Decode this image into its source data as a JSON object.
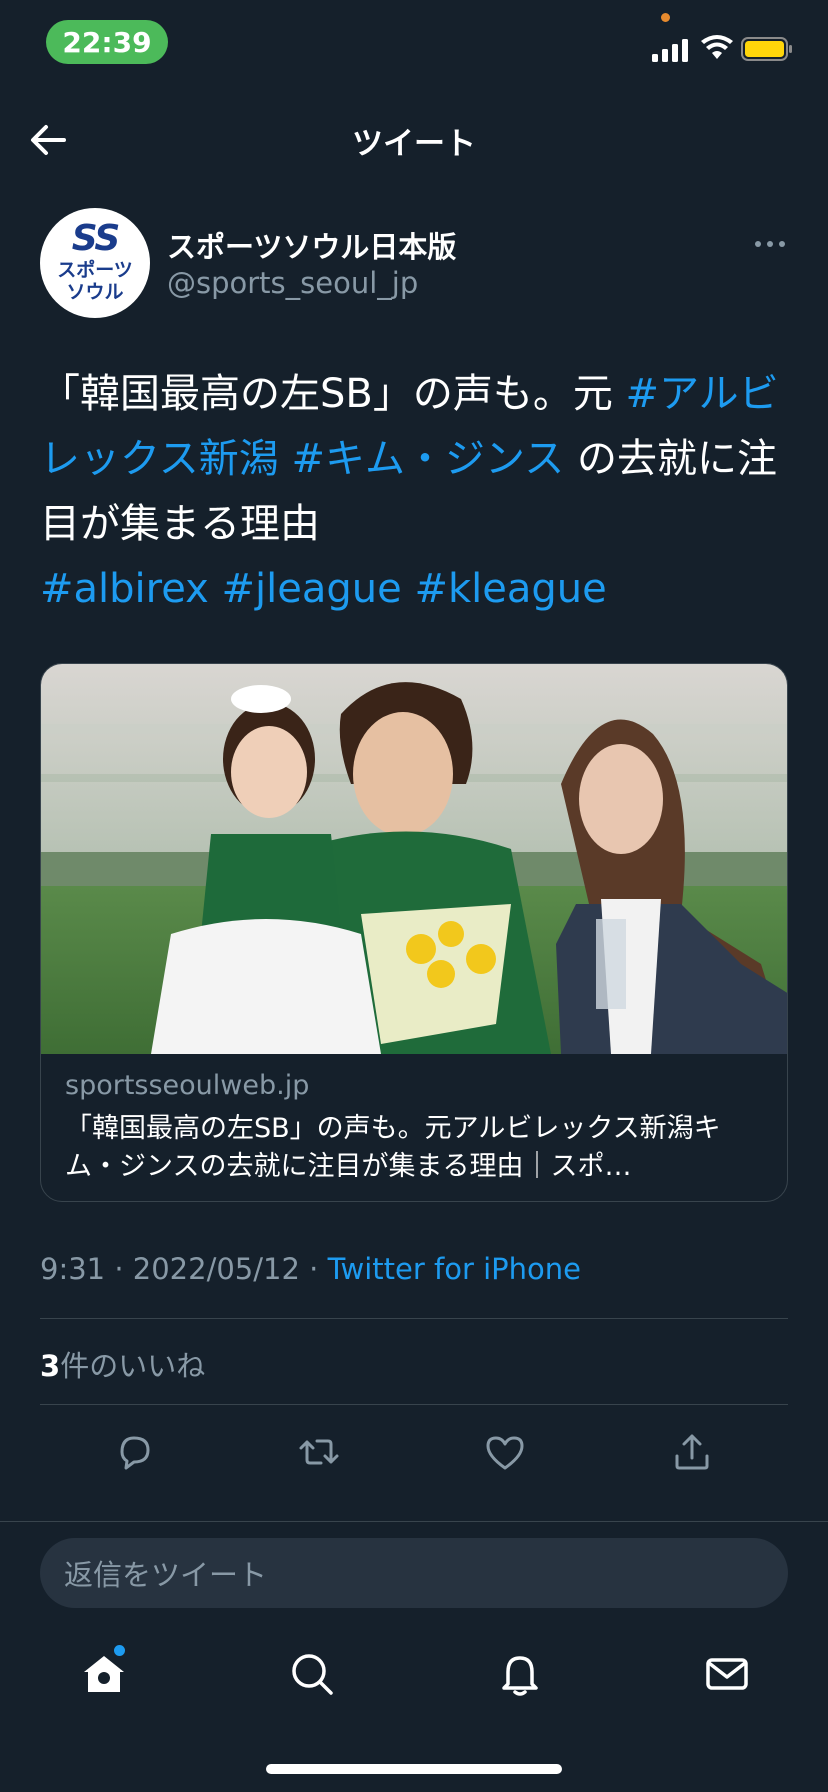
{
  "status_bar": {
    "time": "22:39"
  },
  "header": {
    "title": "ツイート"
  },
  "author": {
    "name": "スポーツソウル日本版",
    "handle": "@sports_seoul_jp",
    "avatar_line1": "SS",
    "avatar_line2": "スポーツ",
    "avatar_line3": "ソウル"
  },
  "tweet": {
    "text_1": "「韓国最高の左SB」の声も。元 ",
    "tag_1": "#アルビレックス新潟",
    "text_2": " ",
    "tag_2": "#キム・ジンス",
    "text_3": " の去就に注目が集まる理由",
    "tag_3": "#albirex",
    "tag_4": "#jleague",
    "tag_5": "#kleague"
  },
  "card": {
    "domain": "sportsseoulweb.jp",
    "title": "「韓国最高の左SB」の声も。元アルビレックス新潟キム・ジンスの去就に注目が集まる理由｜スポ…"
  },
  "meta": {
    "timestamp": "9:31 · 2022/05/12 · ",
    "source": "Twitter for iPhone"
  },
  "likes": {
    "count": "3",
    "label": "件のいいね"
  },
  "reply": {
    "placeholder": "返信をツイート"
  },
  "icons": {
    "back": "arrow-left-icon",
    "more": "more-horizontal-icon",
    "reply": "reply-icon",
    "retweet": "retweet-icon",
    "like": "heart-icon",
    "share": "share-icon",
    "home": "home-icon",
    "search": "search-icon",
    "notifications": "bell-icon",
    "messages": "mail-icon"
  },
  "colors": {
    "background": "#15202b",
    "accent": "#1d9bf0",
    "muted": "#8899a6",
    "status_time_bg": "#4cba5a"
  }
}
